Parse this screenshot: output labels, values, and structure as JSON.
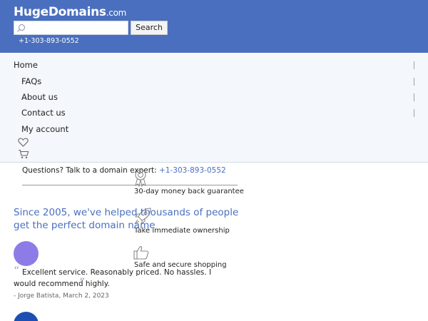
{
  "header": {
    "logo_main": "HugeDomains",
    "logo_suffix": ".com",
    "search_placeholder": "",
    "search_button": "Search",
    "phone": "+1-303-893-0552",
    "bg_color": "#4a6fbe"
  },
  "nav": {
    "items": [
      {
        "label": "Home"
      },
      {
        "label": "FAQs"
      },
      {
        "label": "About us"
      },
      {
        "label": "Contact us"
      },
      {
        "label": "My account"
      }
    ],
    "icons": [
      "heart-icon",
      "cart-icon"
    ]
  },
  "help": {
    "text": "Questions? Talk to a domain expert: ",
    "phone": "+1-303-893-0552"
  },
  "features": [
    {
      "icon": "ribbon-award-icon",
      "text": "30-day money back guarantee"
    },
    {
      "icon": "rocket-icon",
      "text": "Take immediate ownership"
    },
    {
      "icon": "thumbs-up-icon",
      "text": "Safe and secure shopping"
    }
  ],
  "headline": "Since 2005, we've helped thousands of people get the perfect domain name",
  "testimonial": {
    "text": "Excellent service. Reasonably priced. No hassles. I would recommend highly.",
    "author": "- Jorge Batista, March 2, 2023"
  },
  "colors": {
    "accent": "#4a6fbe",
    "avatar1": "#8e7ce6",
    "avatar2": "#1d4fb2"
  }
}
